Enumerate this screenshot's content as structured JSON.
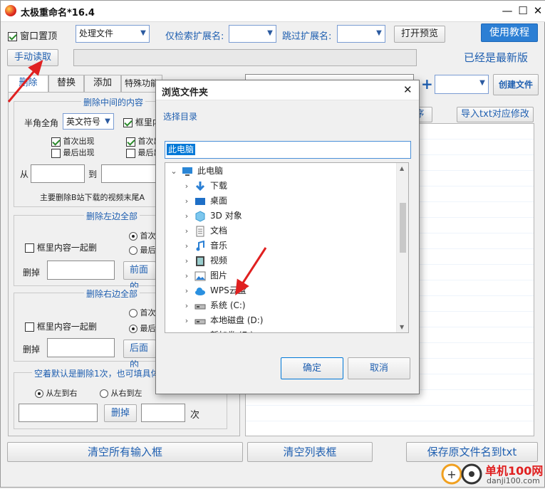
{
  "window": {
    "title": "太极重命名*16.4"
  },
  "toolbar": {
    "window_top_label": "窗口置顶",
    "mode_value": "处理文件",
    "only_ext_label": "仅检索扩展名:",
    "skip_ext_label": "跳过扩展名:",
    "preview_button": "打开预览",
    "tutorial_button": "使用教程",
    "manual_read_button": "手动读取",
    "update_status": "已经是最新版",
    "create_file_button": "创建文件",
    "import_txt_button": "导入txt对应修改",
    "order_button": "序"
  },
  "tabs": [
    "删除",
    "替换",
    "添加",
    "特殊功能"
  ],
  "delete_middle": {
    "title": "删除中间的内容",
    "half_full_label": "半角全角",
    "symbol_value": "英文符号",
    "frame_label": "框里内",
    "first_occurrence": "首次出现",
    "last_occurrence": "最后出现",
    "first_occurrence_2": "首次出",
    "last_occurrence_2": "最后出",
    "from_label": "从",
    "to_label": "到",
    "hint": "主要删除B站下载的视频末尾A"
  },
  "delete_left": {
    "title": "删除左边全部",
    "frame_label": "框里内容一起删",
    "first": "首次",
    "last": "最后",
    "delete_label": "删掉",
    "front_button": "前面的"
  },
  "delete_right": {
    "title": "删除右边全部",
    "frame_label": "框里内容一起删",
    "first": "首次",
    "last": "最后",
    "delete_label": "删掉",
    "back_button": "后面的"
  },
  "blank_group": {
    "title": "空着默认是删除1次，也可填具体",
    "left_to_right": "从左到右",
    "right_to_left": "从右到左",
    "delete_button": "删掉",
    "times_label": "次"
  },
  "bottom": {
    "clear_inputs": "清空所有输入框",
    "clear_list": "清空列表框",
    "save_txt": "保存原文件名到txt"
  },
  "dialog": {
    "title": "浏览文件夹",
    "prompt": "选择目录",
    "path_value": "此电脑",
    "tree": [
      {
        "label": "此电脑",
        "icon": "computer-icon",
        "level": 0,
        "expanded": true
      },
      {
        "label": "下载",
        "icon": "download-folder-icon",
        "level": 1
      },
      {
        "label": "桌面",
        "icon": "desktop-folder-icon",
        "level": 1
      },
      {
        "label": "3D 对象",
        "icon": "3d-objects-icon",
        "level": 1
      },
      {
        "label": "文档",
        "icon": "documents-icon",
        "level": 1
      },
      {
        "label": "音乐",
        "icon": "music-icon",
        "level": 1
      },
      {
        "label": "视频",
        "icon": "video-icon",
        "level": 1
      },
      {
        "label": "图片",
        "icon": "pictures-icon",
        "level": 1
      },
      {
        "label": "WPS云盘",
        "icon": "cloud-icon",
        "level": 1
      },
      {
        "label": "系统 (C:)",
        "icon": "drive-icon",
        "level": 1
      },
      {
        "label": "本地磁盘 (D:)",
        "icon": "drive-icon",
        "level": 1
      },
      {
        "label": "新加卷 (E:)",
        "icon": "drive-icon",
        "level": 1
      }
    ],
    "ok_button": "确定",
    "cancel_button": "取消"
  },
  "watermark": {
    "text": "单机100网",
    "url": "danji100.com"
  },
  "colors": {
    "accent": "#1f5fb0",
    "tutorial_bg": "#2c7fd4",
    "red_arrow": "#e02020"
  }
}
